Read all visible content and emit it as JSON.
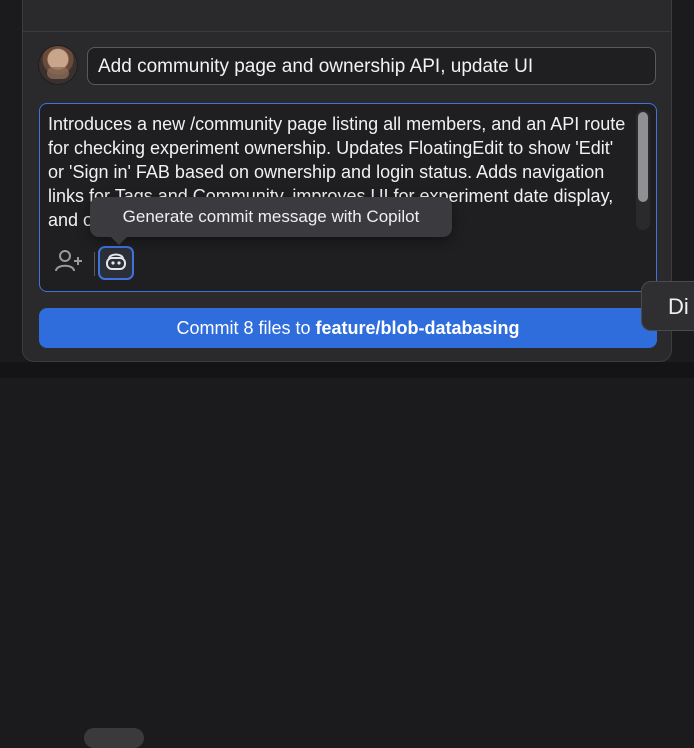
{
  "commit": {
    "summary": "Add community page and ownership API, update UI",
    "description": "Introduces a new /community page listing all members, and an API route for checking experiment ownership. Updates FloatingEdit to show 'Edit' or 'Sign in' FAB based on ownership and login status. Adds navigation links for Tags and Community, improves UI for experiment date display, and other small fixes.",
    "tooltip": "Generate commit message with Copilot",
    "button_prefix": "Commit 8 files to ",
    "branch": "feature/blob-databasing"
  },
  "side_button": {
    "label": "Di"
  },
  "colors": {
    "accent": "#2f6cdc",
    "focus": "#3f73d9"
  },
  "icons": {
    "coauthor": "add-coauthor-icon",
    "copilot": "copilot-icon"
  }
}
